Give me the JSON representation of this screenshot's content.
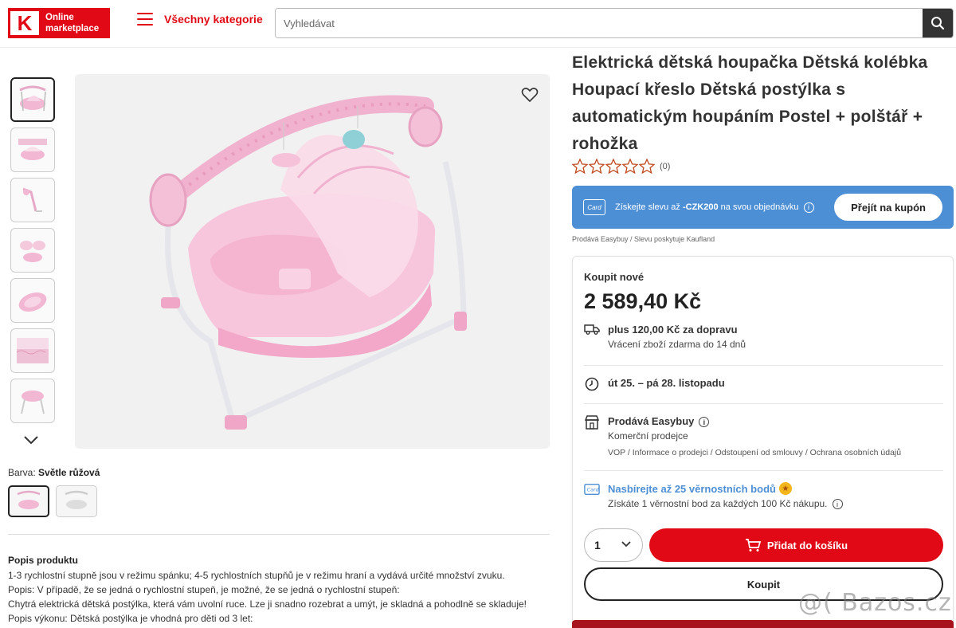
{
  "header": {
    "logo_letter": "K",
    "logo_line1": "Online",
    "logo_line2": "marketplace",
    "categories_label": "Všechny kategorie",
    "search_placeholder": "Vyhledávat"
  },
  "gallery": {
    "thumbnail_count": 7,
    "color_label": "Barva:",
    "color_value": "Světle růžová"
  },
  "product": {
    "title": "Elektrická dětská houpačka Dětská kolébka Houpací křeslo Dětská postýlka s automatickým houpáním Postel + polštář + rohožka",
    "rating_stars": 0,
    "rating_count": "(0)",
    "seller_note": "Prodává Easybuy / Slevu poskytuje Kaufland"
  },
  "coupon": {
    "card_label": "Card",
    "text_prefix": "Získejte slevu až ",
    "amount": "-CZK200",
    "text_suffix": " na svou objednávku",
    "button_label": "Přejít na kupón"
  },
  "buybox": {
    "label": "Koupit nové",
    "price": "2 589,40 Kč",
    "shipping": "plus 120,00 Kč za dopravu",
    "returns": "Vrácení zboží zdarma do 14 dnů",
    "delivery": "út 25. – pá 28. listopadu",
    "seller": "Prodává Easybuy",
    "seller_type": "Komerční prodejce",
    "seller_links": "VOP / Informace o prodejci / Odstoupení od smlouvy / Ochrana osobních údajů",
    "loyalty_title": "Nasbírejte až 25 věrnostních bodů",
    "loyalty_sub": "Získáte 1 věrnostní bod za každých 100 Kč nákupu.",
    "qty": "1",
    "add_to_cart": "Přidat do košíku",
    "buy_now": "Koupit"
  },
  "description": {
    "title": "Popis produktu",
    "lines": [
      "1-3 rychlostní stupně jsou v režimu spánku; 4-5 rychlostních stupňů je v režimu hraní a vydává určité množství zvuku.",
      "Popis: V případě, že se jedná o rychlostní stupeň, je možné, že se jedná o rychlostní stupeň:",
      "Chytrá elektrická dětská postýlka, která vám uvolní ruce. Lze ji snadno rozebrat a umýt, je skladná a pohodlně se skladuje!",
      "Popis výkonu: Dětská postýlka je vhodná pro děti od 3 let:"
    ]
  },
  "watermark": "@( Bazos.cz",
  "colors": {
    "brand_red": "#e10915",
    "coupon_blue": "#4d8fd5",
    "star_outline": "#c0461b"
  }
}
